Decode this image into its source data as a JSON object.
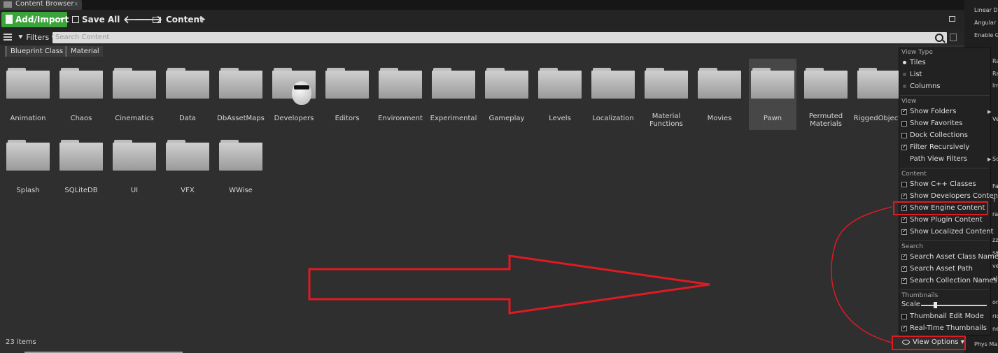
{
  "window": {
    "tab_label": "Content Browser",
    "tab_close": "x"
  },
  "toolbar": {
    "add_import": "Add/Import",
    "save_all": "Save All",
    "back_arrow": "🡐",
    "forward_arrow": "🡒",
    "breadcrumb": "Content",
    "breadcrumb_caret": "▸",
    "dropdown_caret": "▾"
  },
  "filterbar": {
    "filters_label": "Filters",
    "search_placeholder": "Search Content"
  },
  "chips": [
    "Blueprint Class",
    "Material"
  ],
  "folders": [
    {
      "name": "Animation"
    },
    {
      "name": "Chaos"
    },
    {
      "name": "Cinematics"
    },
    {
      "name": "Data"
    },
    {
      "name": "DbAssetMaps"
    },
    {
      "name": "Developers"
    },
    {
      "name": "Editors"
    },
    {
      "name": "Environment"
    },
    {
      "name": "Experimental"
    },
    {
      "name": "Gameplay"
    },
    {
      "name": "Levels"
    },
    {
      "name": "Localization"
    },
    {
      "name": "Material Functions"
    },
    {
      "name": "Movies"
    },
    {
      "name": "Pawn"
    },
    {
      "name": "Permuted Materials"
    },
    {
      "name": "RiggedObjects"
    },
    {
      "name": "Splash"
    },
    {
      "name": "SQLiteDB"
    },
    {
      "name": "UI"
    },
    {
      "name": "VFX"
    },
    {
      "name": "WWise"
    }
  ],
  "selected_folder": "Pawn",
  "status": {
    "item_count": "23 items"
  },
  "view_options": {
    "button_label": "View Options",
    "view_type": {
      "header": "View Type",
      "options": [
        "Tiles",
        "List",
        "Columns"
      ],
      "selected": "Tiles"
    },
    "view": {
      "header": "View",
      "items": [
        {
          "label": "Show Folders",
          "checked": true,
          "submenu": true
        },
        {
          "label": "Show Favorites",
          "checked": false
        },
        {
          "label": "Dock Collections",
          "checked": false
        },
        {
          "label": "Filter Recursively",
          "checked": true
        },
        {
          "label": "Path View Filters",
          "checked": null,
          "submenu": true
        }
      ]
    },
    "content": {
      "header": "Content",
      "items": [
        {
          "label": "Show C++ Classes",
          "checked": false
        },
        {
          "label": "Show Developers Content",
          "checked": true
        },
        {
          "label": "Show Engine Content",
          "checked": true
        },
        {
          "label": "Show Plugin Content",
          "checked": true
        },
        {
          "label": "Show Localized Content",
          "checked": true
        }
      ]
    },
    "search": {
      "header": "Search",
      "items": [
        {
          "label": "Search Asset Class Names",
          "checked": true
        },
        {
          "label": "Search Asset Path",
          "checked": true
        },
        {
          "label": "Search Collection Names",
          "checked": true
        }
      ]
    },
    "thumbnails": {
      "header": "Thumbnails",
      "scale_label": "Scale",
      "scale_value": 0.2,
      "items": [
        {
          "label": "Thumbnail Edit Mode",
          "checked": false
        },
        {
          "label": "Real-Time Thumbnails",
          "checked": true
        }
      ]
    }
  },
  "right_panel": {
    "labels": [
      "Linear D",
      "Angular I",
      "Enable G",
      "Phys Ma"
    ],
    "fragments": [
      "Ra",
      "Ra",
      "lm",
      "Vel",
      "Sc",
      "Fa",
      "T",
      "ra",
      "zza",
      "sa",
      "ric",
      "ve",
      "ne",
      "al U",
      "ora"
    ]
  },
  "colors": {
    "accent_green": "#3aa33a",
    "annotation_red": "#e01a22"
  }
}
